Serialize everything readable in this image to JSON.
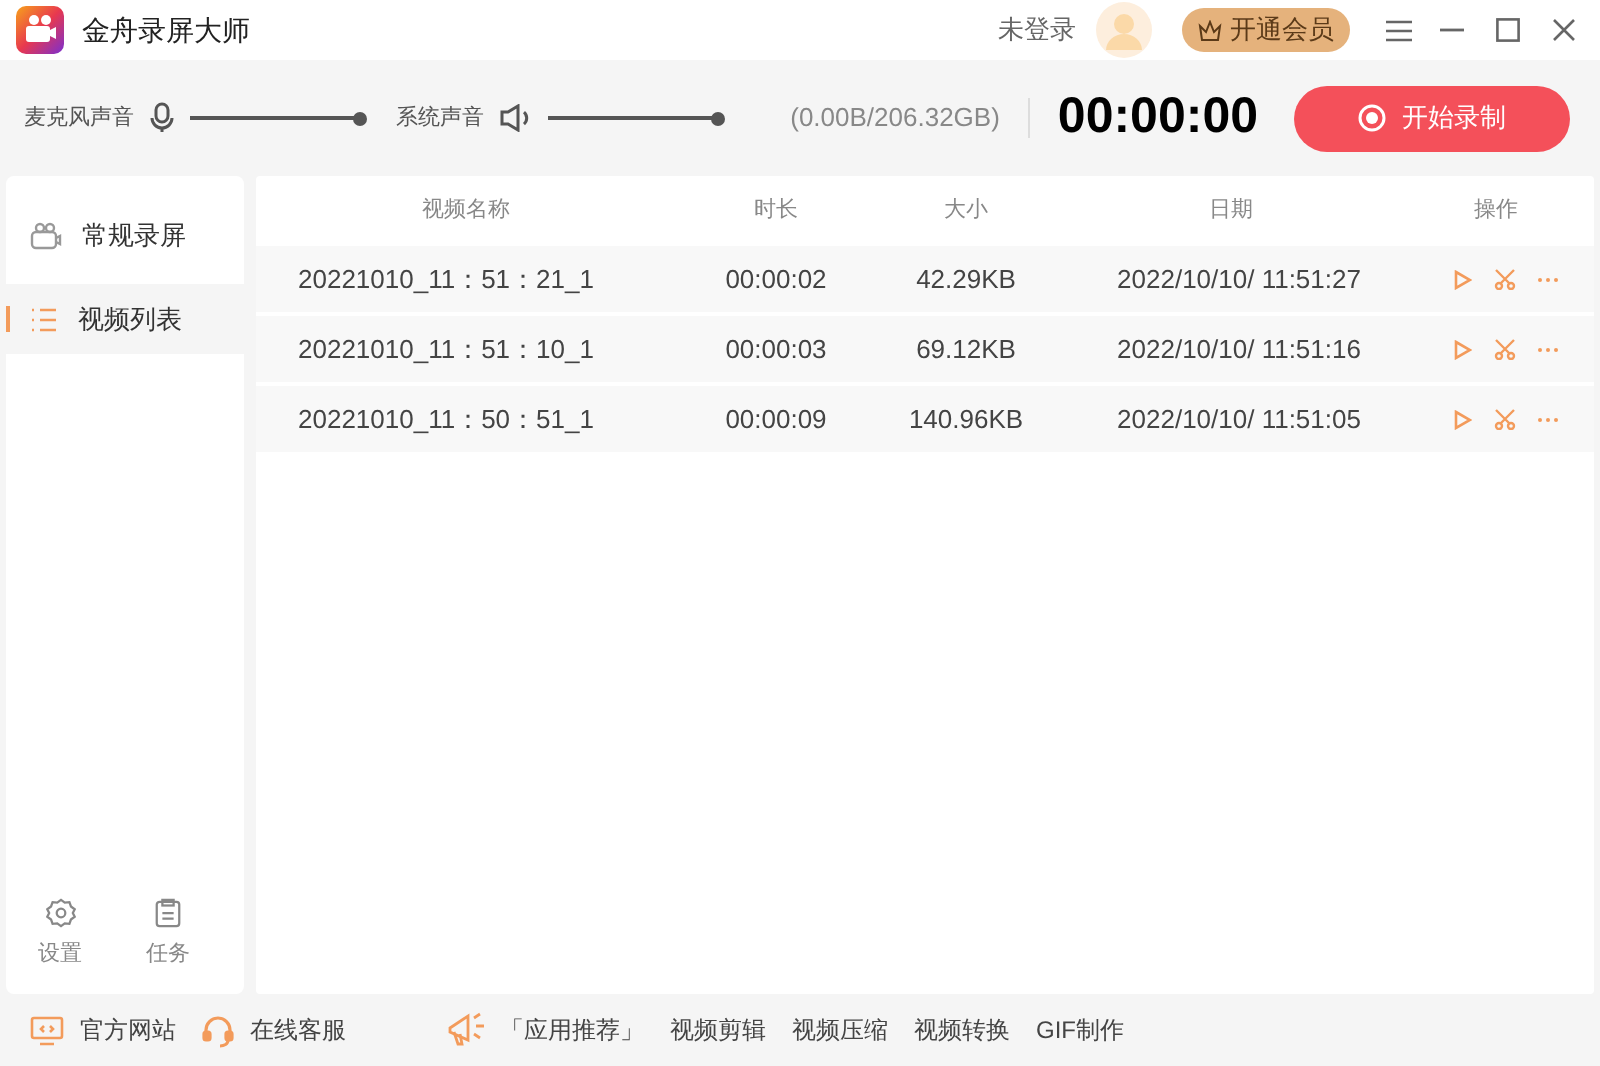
{
  "window": {
    "title": "金舟录屏大师"
  },
  "account": {
    "status": "未登录",
    "vip_button": "开通会员"
  },
  "audio": [
    {
      "label": "麦克风声音",
      "kind": "mic",
      "level": 1.0
    },
    {
      "label": "系统声音",
      "kind": "speaker",
      "level": 1.0
    }
  ],
  "storage": "(0.00B/206.32GB)",
  "timer": "00:00:00",
  "record_button": "开始录制",
  "sidebar": {
    "items": [
      {
        "label": "常规录屏",
        "kind": "camera",
        "selected": false
      },
      {
        "label": "视频列表",
        "kind": "list",
        "selected": true
      }
    ],
    "bottom": [
      {
        "label": "设置",
        "kind": "gear"
      },
      {
        "label": "任务",
        "kind": "clipboard"
      }
    ]
  },
  "table": {
    "columns": [
      "视频名称",
      "时长",
      "大小",
      "日期",
      "操作"
    ],
    "rows": [
      {
        "name": "20221010_11：51：21_1",
        "duration": "00:00:02",
        "size": "42.29KB",
        "date": "2022/10/10/ 11:51:27"
      },
      {
        "name": "20221010_11：51：10_1",
        "duration": "00:00:03",
        "size": "69.12KB",
        "date": "2022/10/10/ 11:51:16"
      },
      {
        "name": "20221010_11：50：51_1",
        "duration": "00:00:09",
        "size": "140.96KB",
        "date": "2022/10/10/ 11:51:05"
      }
    ]
  },
  "footer": {
    "links": [
      {
        "label": "官方网站",
        "kind": "monitor"
      },
      {
        "label": "在线客服",
        "kind": "headset"
      }
    ],
    "promo_label": "「应用推荐」",
    "tools": [
      "视频剪辑",
      "视频压缩",
      "视频转换",
      "GIF制作"
    ]
  }
}
